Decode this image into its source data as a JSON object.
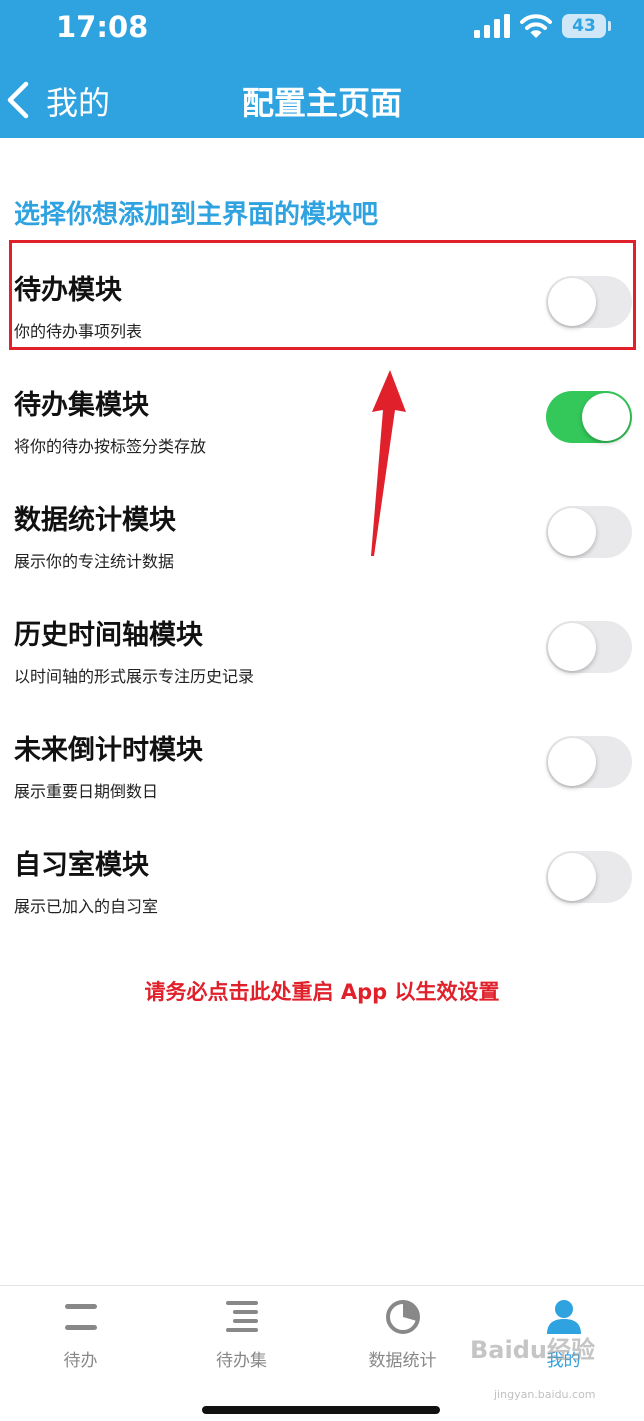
{
  "status_bar": {
    "time": "17:08",
    "battery": "43"
  },
  "nav": {
    "back_label": "我的",
    "title": "配置主页面"
  },
  "section_title": "选择你想添加到主界面的模块吧",
  "modules": [
    {
      "title": "待办模块",
      "desc": "你的待办事项列表",
      "enabled": false
    },
    {
      "title": "待办集模块",
      "desc": "将你的待办按标签分类存放",
      "enabled": true
    },
    {
      "title": "数据统计模块",
      "desc": "展示你的专注统计数据",
      "enabled": false
    },
    {
      "title": "历史时间轴模块",
      "desc": "以时间轴的形式展示专注历史记录",
      "enabled": false
    },
    {
      "title": "未来倒计时模块",
      "desc": "展示重要日期倒数日",
      "enabled": false
    },
    {
      "title": "自习室模块",
      "desc": "展示已加入的自习室",
      "enabled": false
    }
  ],
  "restart_note": "请务必点击此处重启 App 以生效设置",
  "tabs": [
    {
      "label": "待办",
      "icon": "list-icon",
      "active": false
    },
    {
      "label": "待办集",
      "icon": "stacked-list-icon",
      "active": false
    },
    {
      "label": "数据统计",
      "icon": "pie-chart-icon",
      "active": false
    },
    {
      "label": "我的",
      "icon": "person-icon",
      "active": true
    }
  ],
  "watermark": {
    "brand": "Baidu经验",
    "url": "jingyan.baidu.com"
  },
  "colors": {
    "header": "#2fa2e0",
    "toggle_on": "#34c759",
    "toggle_off": "#e9e9eb",
    "annotation": "#e0202a",
    "tab_active": "#2fa2e0",
    "tab_inactive": "#888888"
  }
}
